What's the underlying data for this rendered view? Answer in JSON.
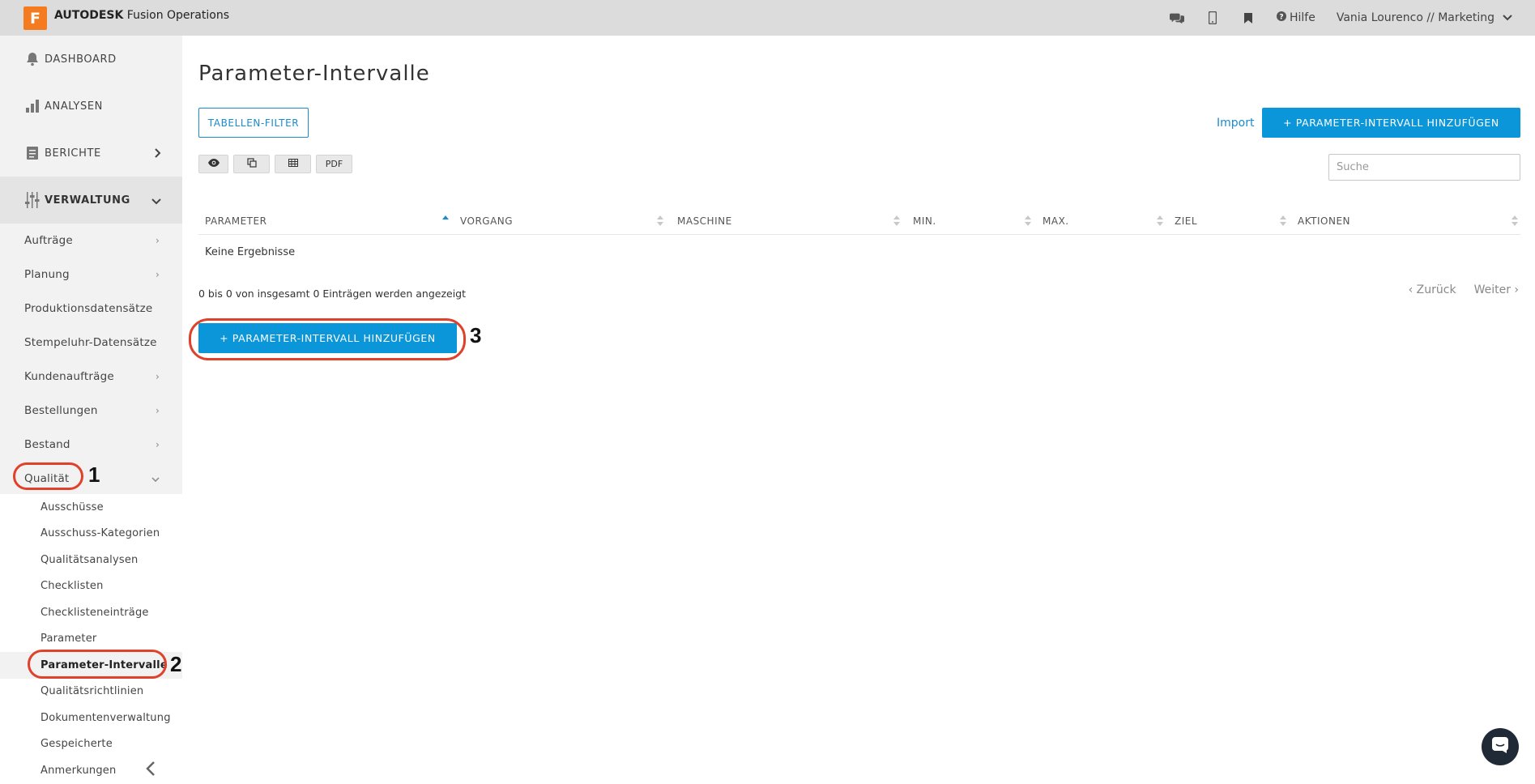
{
  "header": {
    "logo_letter": "F",
    "brand_bold": "AUTODESK",
    "brand_rest": " Fusion Operations",
    "help_label": "Hilfe",
    "user_label": "Vania Lourenco // Marketing",
    "icons": [
      "chat-icon",
      "mobile-icon",
      "bookmark-icon",
      "help-icon",
      "chevron-down-icon"
    ]
  },
  "sidebar": {
    "top_items": [
      {
        "label": "DASHBOARD",
        "icon": "bell-icon"
      },
      {
        "label": "ANALYSEN",
        "icon": "bar-chart-icon"
      },
      {
        "label": "BERICHTE",
        "icon": "report-icon"
      },
      {
        "label": "VERWALTUNG",
        "icon": "sliders-icon"
      }
    ],
    "items": [
      {
        "label": "Aufträge"
      },
      {
        "label": "Planung"
      },
      {
        "label": "Produktionsdatensätze"
      },
      {
        "label": "Stempeluhr-Datensätze"
      },
      {
        "label": "Kundenaufträge"
      },
      {
        "label": "Bestellungen"
      },
      {
        "label": "Bestand"
      },
      {
        "label": "Qualität"
      }
    ],
    "sub_items": [
      {
        "label": "Ausschüsse"
      },
      {
        "label": "Ausschuss-Kategorien"
      },
      {
        "label": "Qualitätsanalysen"
      },
      {
        "label": "Checklisten"
      },
      {
        "label": "Checklisteneinträge"
      },
      {
        "label": "Parameter"
      },
      {
        "label": "Parameter-Intervalle"
      },
      {
        "label": "Qualitätsrichtlinien"
      },
      {
        "label": "Dokumentenverwaltung"
      },
      {
        "label": "Gespeicherte"
      },
      {
        "label": "Anmerkungen"
      }
    ]
  },
  "main": {
    "title": "Parameter-Intervalle",
    "filter_button": "TABELLEN-FILTER",
    "import_link": "Import",
    "add_button": "+ PARAMETER-INTERVALL HINZUFÜGEN",
    "tools": {
      "pdf": "PDF"
    },
    "search_placeholder": "Suche",
    "columns": [
      "PARAMETER",
      "VORGANG",
      "MASCHINE",
      "MIN.",
      "MAX.",
      "ZIEL",
      "AKTIONEN"
    ],
    "empty_text": "Keine Ergebnisse",
    "info_text": "0 bis 0 von insgesamt 0 Einträgen werden angezeigt",
    "pager": {
      "prev": "‹ Zurück",
      "next": "Weiter ›"
    },
    "add_button_bottom": "+ PARAMETER-INTERVALL HINZUFÜGEN"
  },
  "annotations": [
    "1",
    "2",
    "3"
  ],
  "colors": {
    "accent": "#0a96d8",
    "brand": "#f47b20",
    "annotation": "#e0412b"
  }
}
